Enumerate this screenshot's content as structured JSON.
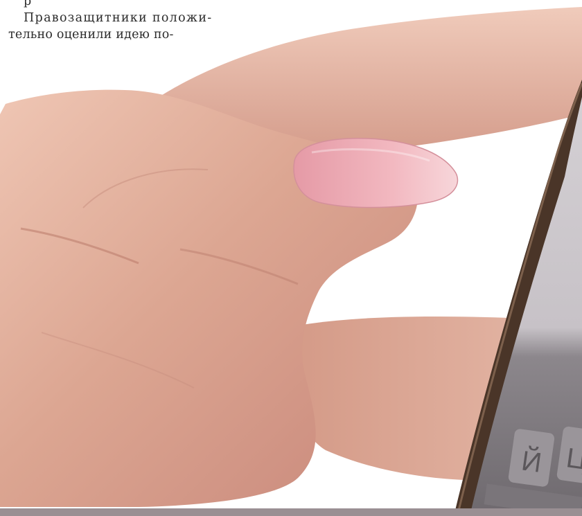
{
  "article": {
    "cut_line": "р",
    "line_1": "Правозащитники положи-",
    "line_2": "тельно оценили идею по-"
  },
  "keyboard": {
    "key_1": "Й",
    "key_2": "Ц"
  },
  "colors": {
    "text": "#2b2b2b",
    "skin": "#d9a493",
    "skin_shadow": "#b97a6a",
    "nail": "#e9a9b1",
    "phone_frame": "#4a3528",
    "phone_screen": "#c9c4c9",
    "key": "#9a959a",
    "bottom_band": "#9a8f93"
  },
  "icons": {
    "photo": "hand-with-smartphone-photo"
  }
}
